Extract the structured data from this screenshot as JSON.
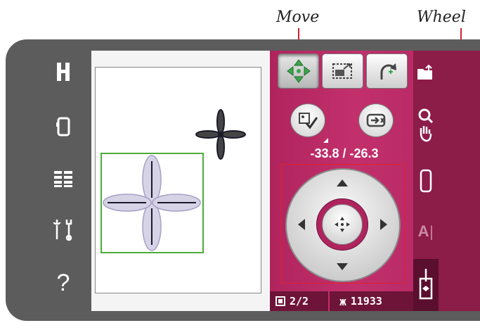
{
  "annotations": {
    "move": "Move",
    "wheel": "Wheel"
  },
  "sidebar": {
    "items": [
      {
        "name": "embroidery-h-icon"
      },
      {
        "name": "hoop-icon"
      },
      {
        "name": "menu-list-icon"
      },
      {
        "name": "tools-icon"
      },
      {
        "name": "help-icon"
      }
    ]
  },
  "toolbar": {
    "buttons": [
      {
        "name": "move-icon",
        "active": true
      },
      {
        "name": "scale-icon",
        "active": false
      },
      {
        "name": "rotate-icon",
        "active": false
      }
    ]
  },
  "coords": "-33.8 / -26.3",
  "status": {
    "page": "2/2",
    "stitches": "11933"
  },
  "right_icons": [
    "load-design-icon",
    "zoom-pan-icon",
    "hoop-select-icon",
    "text-icon",
    "embroider-icon"
  ],
  "colors": {
    "accent": "#b0245e",
    "callout": "#d42030",
    "selection": "#4cae3a"
  }
}
